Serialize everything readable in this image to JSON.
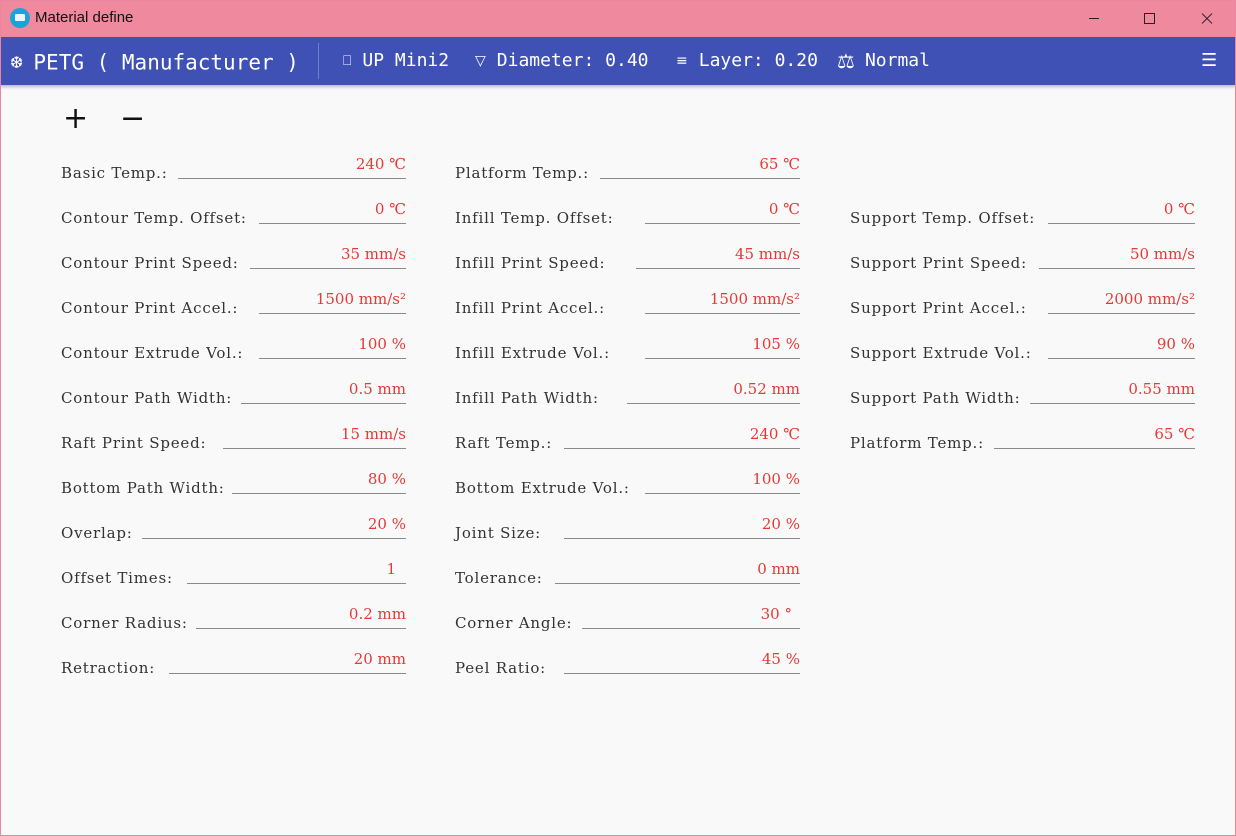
{
  "window": {
    "title": "Material define"
  },
  "toolbar": {
    "material": "PETG ( Manufacturer )",
    "printer": "UP Mini2",
    "diameter": "Diameter: 0.40",
    "layer": "Layer: 0.20",
    "quality": "Normal"
  },
  "actions": {
    "add": "+",
    "remove": "−"
  },
  "fields": {
    "col1": [
      {
        "label": "Basic Temp.:",
        "value": "240 ℃"
      },
      {
        "label": "Contour Temp. Offset:",
        "value": "0 ℃"
      },
      {
        "label": "Contour Print Speed:",
        "value": "35 mm/s"
      },
      {
        "label": "Contour Print Accel.:",
        "value": "1500 mm/s²"
      },
      {
        "label": "Contour Extrude Vol.:",
        "value": "100 %"
      },
      {
        "label": "Contour Path Width:",
        "value": "0.5 mm"
      },
      {
        "label": "Raft Print Speed:",
        "value": "15 mm/s"
      },
      {
        "label": "Bottom Path Width:",
        "value": "80 %"
      },
      {
        "label": "Overlap:",
        "value": "20 %"
      },
      {
        "label": "Offset Times:",
        "value": "1"
      },
      {
        "label": "Corner Radius:",
        "value": "0.2 mm"
      },
      {
        "label": "Retraction:",
        "value": "20 mm"
      }
    ],
    "col2": [
      {
        "label": "Platform Temp.:",
        "value": "65 ℃"
      },
      {
        "label": "Infill Temp. Offset:",
        "value": "0 ℃"
      },
      {
        "label": "Infill Print Speed:",
        "value": "45 mm/s"
      },
      {
        "label": "Infill Print Accel.:",
        "value": "1500 mm/s²"
      },
      {
        "label": "Infill Extrude Vol.:",
        "value": "105 %"
      },
      {
        "label": "Infill Path Width:",
        "value": "0.52 mm"
      },
      {
        "label": "Raft Temp.:",
        "value": "240 ℃"
      },
      {
        "label": "Bottom Extrude Vol.:",
        "value": "100 %"
      },
      {
        "label": "Joint Size:",
        "value": "20 %"
      },
      {
        "label": "Tolerance:",
        "value": "0 mm"
      },
      {
        "label": "Corner Angle:",
        "value": "30 °"
      },
      {
        "label": "Peel Ratio:",
        "value": "45 %"
      }
    ],
    "col3": [
      {
        "label": "Support Temp. Offset:",
        "value": "0 ℃"
      },
      {
        "label": "Support Print Speed:",
        "value": "50 mm/s"
      },
      {
        "label": "Support Print Accel.:",
        "value": "2000 mm/s²"
      },
      {
        "label": "Support Extrude Vol.:",
        "value": "90 %"
      },
      {
        "label": "Support Path Width:",
        "value": "0.55 mm"
      },
      {
        "label": "Platform Temp.:",
        "value": "65 ℃"
      }
    ]
  }
}
